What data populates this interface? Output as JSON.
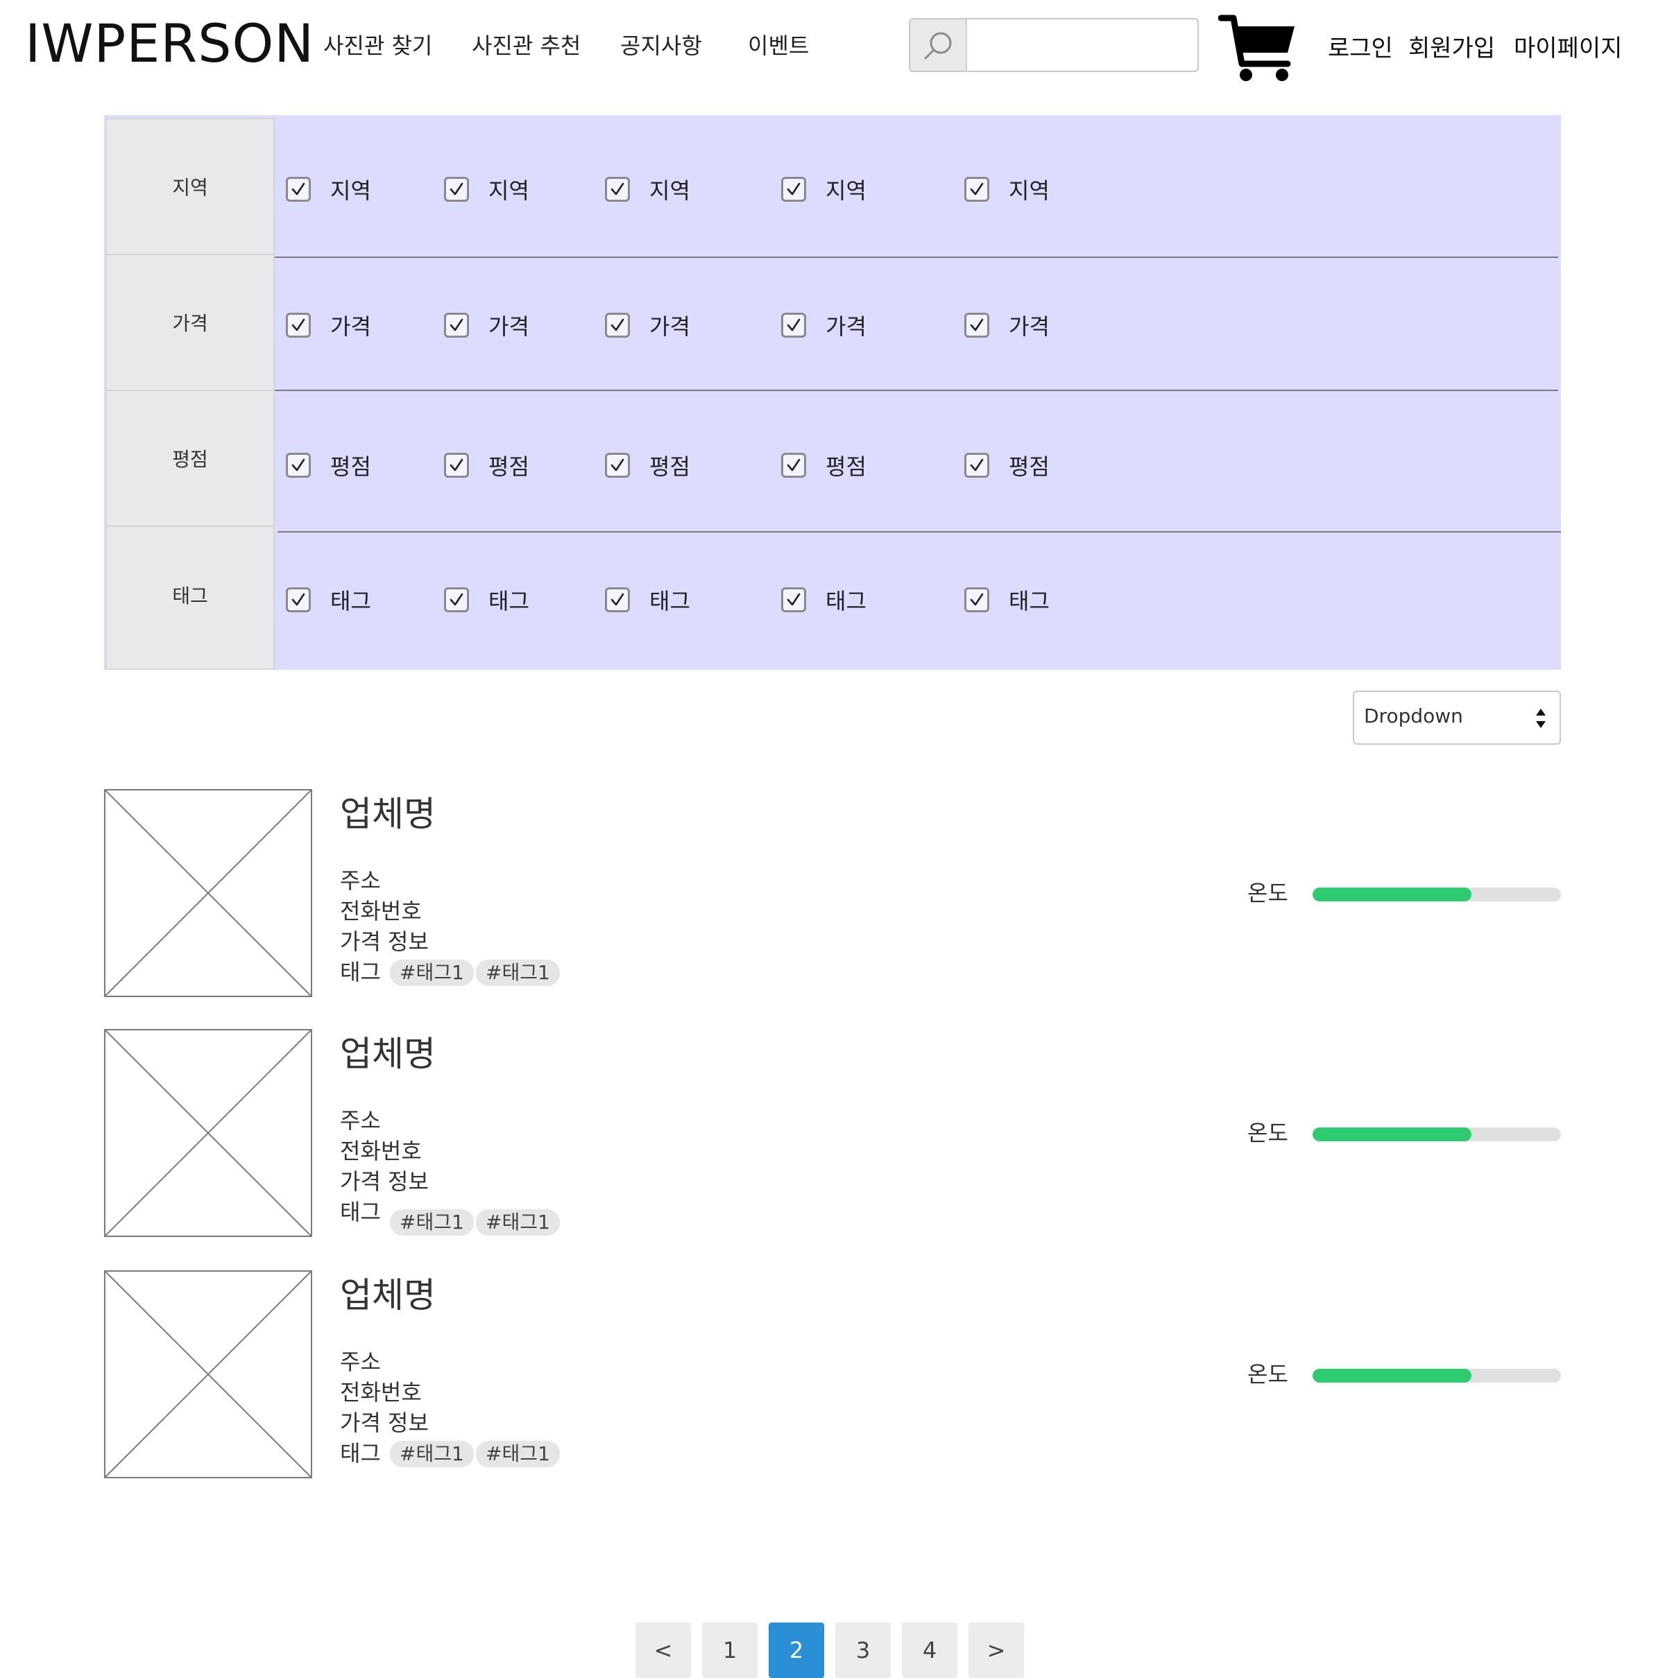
{
  "header": {
    "logo": "IWPERSON",
    "nav": [
      "사진관 찾기",
      "사진관 추천",
      "공지사항",
      "이벤트"
    ],
    "search": {
      "placeholder": "",
      "value": ""
    },
    "auth": [
      "로그인",
      "회원가입",
      "마이페이지"
    ]
  },
  "filters": [
    {
      "label": "지역",
      "options": [
        "지역",
        "지역",
        "지역",
        "지역",
        "지역"
      ]
    },
    {
      "label": "가격",
      "options": [
        "가격",
        "가격",
        "가격",
        "가격",
        "가격"
      ]
    },
    {
      "label": "평점",
      "options": [
        "평점",
        "평점",
        "평점",
        "평점",
        "평점"
      ]
    },
    {
      "label": "태그",
      "options": [
        "태그",
        "태그",
        "태그",
        "태그",
        "태그"
      ]
    }
  ],
  "filter_checked": true,
  "sort": {
    "label": "Dropdown"
  },
  "listings": [
    {
      "name": "업체명",
      "address": "주소",
      "phone": "전화번호",
      "price": "가격 정보",
      "tag_label": "태그",
      "tags": [
        "#태그1",
        "#태그1"
      ],
      "temp_label": "온도",
      "temp_level": 0.64
    },
    {
      "name": "업체명",
      "address": "주소",
      "phone": "전화번호",
      "price": "가격 정보",
      "tag_label": "태그",
      "tags": [
        "#태그1",
        "#태그1"
      ],
      "temp_label": "온도",
      "temp_level": 0.64
    },
    {
      "name": "업체명",
      "address": "주소",
      "phone": "전화번호",
      "price": "가격 정보",
      "tag_label": "태그",
      "tags": [
        "#태그1",
        "#태그1"
      ],
      "temp_label": "온도",
      "temp_level": 0.64
    }
  ],
  "pagination": {
    "prev": "<",
    "pages": [
      "1",
      "2",
      "3",
      "4"
    ],
    "next": ">",
    "current": "2"
  },
  "colors": {
    "filter_bg": "#dcdcff",
    "accent": "#2b8fd6",
    "temp_fill": "#2ecc71"
  },
  "icons": {
    "search": "search-icon",
    "cart": "cart-icon",
    "check": "checkmark-icon",
    "image": "image-placeholder-icon"
  }
}
